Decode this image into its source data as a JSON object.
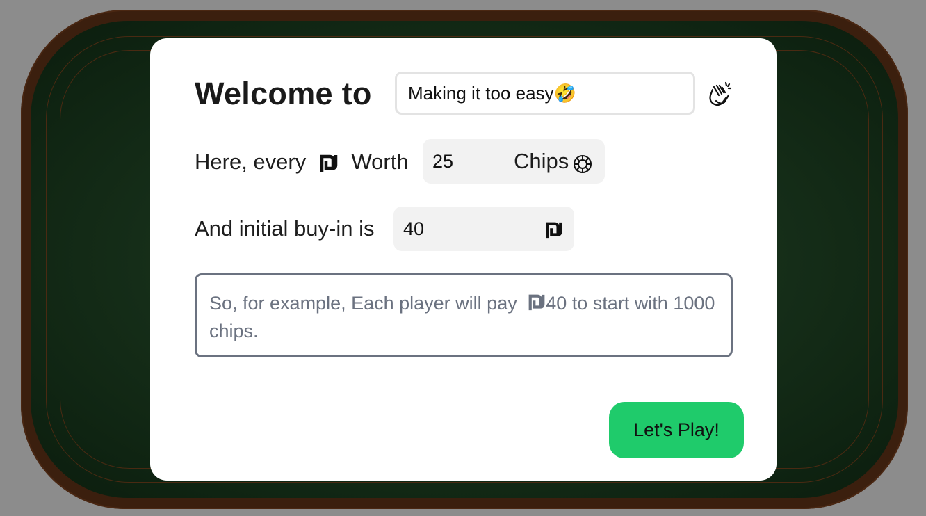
{
  "welcome": {
    "heading": "Welcome to",
    "game_name_value": "Making it too easy🤣",
    "clap_icon": "clapping-hands-icon"
  },
  "rate": {
    "prefix": "Here, every",
    "currency_icon": "shekel-icon",
    "worth_label": "Worth",
    "chips_value": "25",
    "chips_label": "Chips",
    "chip_icon": "poker-chip-icon"
  },
  "buyin": {
    "label": "And initial buy-in is",
    "value": "40",
    "currency_icon": "shekel-icon"
  },
  "example": {
    "part1": "So, for example, Each player will pay",
    "part2": "40 to start with 1000 chips."
  },
  "actions": {
    "play_label": "Let's Play!"
  },
  "colors": {
    "play_button": "#1fcb6b",
    "felt": "#17301a",
    "rim": "#3b1f0e"
  }
}
